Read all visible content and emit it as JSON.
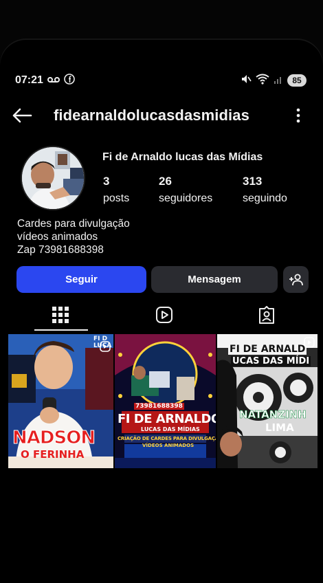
{
  "status_bar": {
    "time": "07:21",
    "battery": "85"
  },
  "header": {
    "username": "fidearnaldolucasdasmidias"
  },
  "profile": {
    "display_name": "Fi de Arnaldo lucas das Mídias",
    "stats": [
      {
        "value": "3",
        "label": "posts"
      },
      {
        "value": "26",
        "label": "seguidores"
      },
      {
        "value": "313",
        "label": "seguindo"
      }
    ],
    "bio": [
      "Cardes para divulgação",
      "vídeos animados",
      "Zap 73981688398"
    ]
  },
  "actions": {
    "follow": "Seguir",
    "message": "Mensagem"
  },
  "tabs": [
    "grid-icon",
    "reels-icon",
    "tagged-icon"
  ],
  "posts": [
    {
      "title": "NADSON",
      "subtitle": "O FERINHA",
      "corner": "FI D LUCA"
    },
    {
      "title": "FI DE ARNALDO",
      "subtitle": "LUCAS DAS MÍDIAS",
      "phone": "73981688398",
      "tagline1": "CRIAÇÃO DE CARDES PARA DIVULGAÇÃ",
      "tagline2": "VÍDEOS ANIMADOS"
    },
    {
      "title": "FI DE ARNALD",
      "subtitle": "UCAS DAS MÍDI",
      "name1": "NATANZINH",
      "name2": "LIMA"
    }
  ],
  "colors": {
    "follow_button": "#2b47f0",
    "secondary_button": "#2a2b30",
    "background": "#000000"
  }
}
